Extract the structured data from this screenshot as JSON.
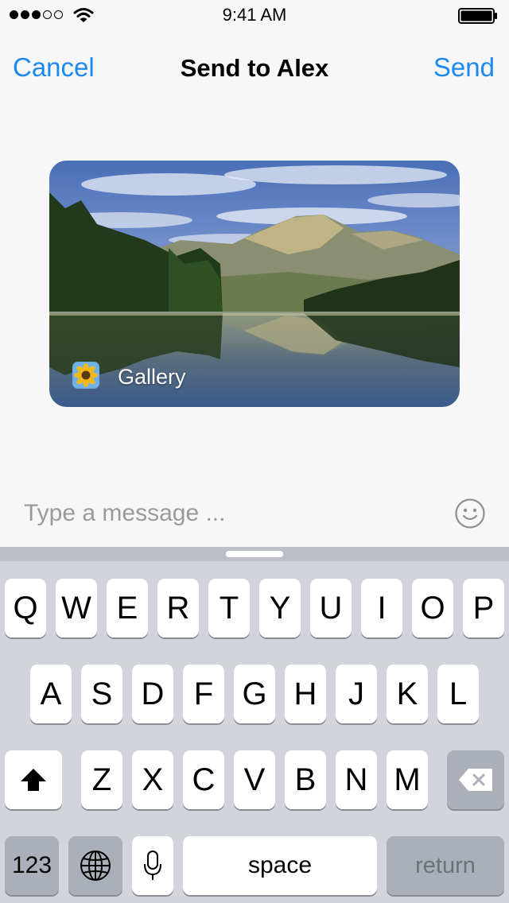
{
  "status_bar": {
    "time": "9:41 AM",
    "signal_strength": 3,
    "signal_total": 5,
    "icons": [
      "signal-dots-icon",
      "wifi-icon",
      "battery-icon"
    ]
  },
  "nav": {
    "cancel_label": "Cancel",
    "title": "Send to Alex",
    "send_label": "Send",
    "accent_color": "#1a8af0"
  },
  "attachment": {
    "source_label": "Gallery",
    "app_icon": "sunflower-icon",
    "image": "mountain-lake-landscape"
  },
  "composer": {
    "placeholder": "Type a message ...",
    "emoji_icon": "smiley-icon"
  },
  "keyboard": {
    "row1": [
      "Q",
      "W",
      "E",
      "R",
      "T",
      "Y",
      "U",
      "I",
      "O",
      "P"
    ],
    "row2": [
      "A",
      "S",
      "D",
      "F",
      "G",
      "H",
      "J",
      "K",
      "L"
    ],
    "row3": [
      "Z",
      "X",
      "C",
      "V",
      "B",
      "N",
      "M"
    ],
    "numbers_label": "123",
    "space_label": "space",
    "return_label": "return",
    "icons": [
      "shift-icon",
      "backspace-icon",
      "globe-icon",
      "microphone-icon"
    ]
  }
}
